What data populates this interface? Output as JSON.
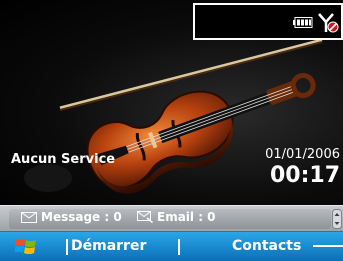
{
  "status": {
    "battery_icon": "battery-full-icon",
    "signal_icon": "no-signal-icon"
  },
  "home": {
    "service_status": "Aucun Service",
    "date": "01/01/2006",
    "time": "00:17"
  },
  "notifications": {
    "message_label": "Message : 0",
    "email_label": "Email : 0",
    "message_icon": "envelope-icon",
    "email_icon": "email-icon"
  },
  "softkeys": {
    "left_label": "Démarrer",
    "right_label": "Contacts",
    "start_icon": "windows-logo-icon"
  },
  "colors": {
    "softkey_bar": "#1e8fd6",
    "strip": "#aeb2b6"
  }
}
